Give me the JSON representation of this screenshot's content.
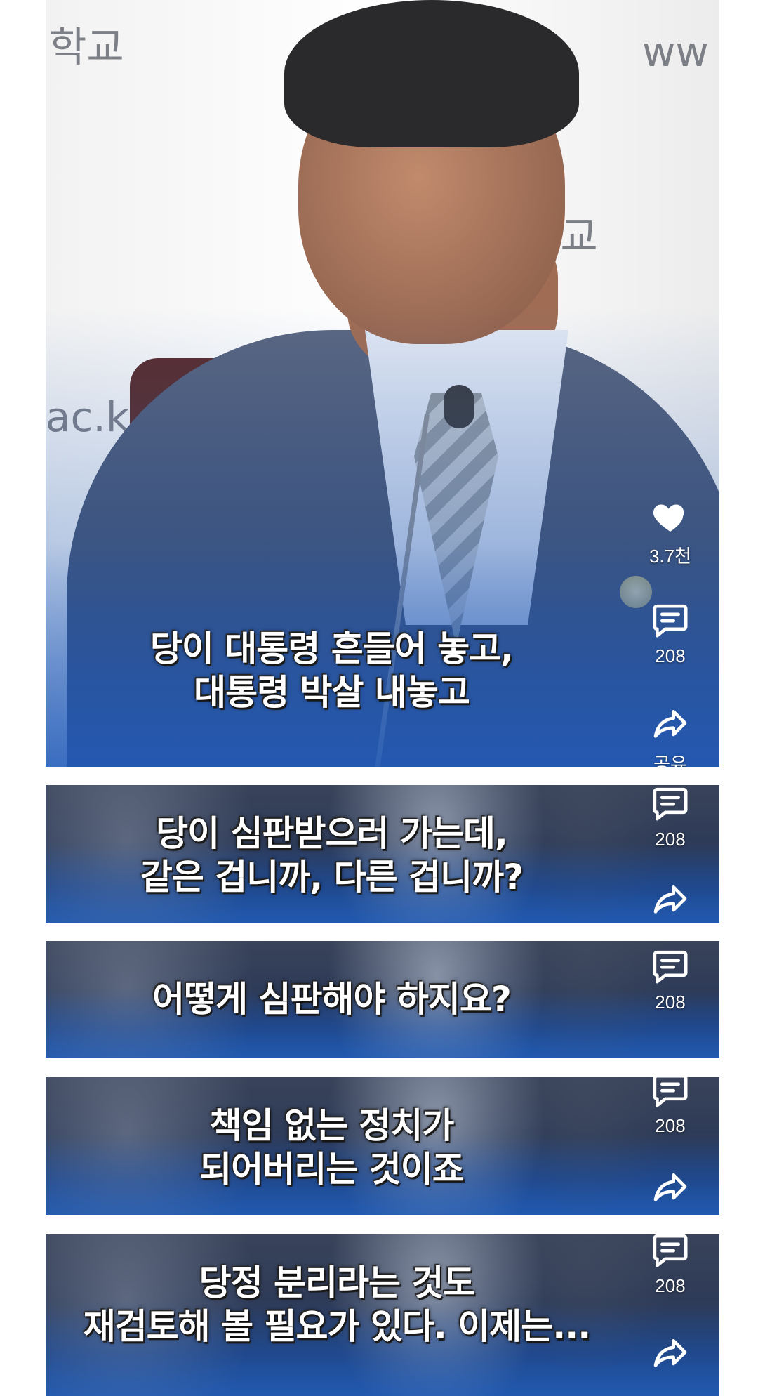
{
  "panels": [
    {
      "caption": "당이 대통령 흔들어 놓고,\n대통령 박살 내놓고",
      "like_count": "3.7천",
      "comment_count": "208",
      "share_label": "공유"
    },
    {
      "caption": "당이 심판받으러 가는데,\n같은 겁니까, 다른 겁니까?",
      "comment_count": "208"
    },
    {
      "caption": "어떻게 심판해야 하지요?",
      "comment_count": "208"
    },
    {
      "caption": "책임 없는 정치가\n되어버리는 것이죠",
      "comment_count": "208"
    },
    {
      "caption": "당정 분리라는 것도\n재검토해 볼 필요가 있다. 이제는...",
      "comment_count": "208"
    }
  ],
  "background_text": {
    "school_1": "학교",
    "school_2": "학교",
    "www": "ww",
    "domain": "ac.k"
  },
  "icons": {
    "like": "heart-icon",
    "comment": "comment-icon",
    "share": "share-icon"
  },
  "colors": {
    "caption_text": "#ffffff",
    "bottom_glow": "#1c4f9c"
  }
}
